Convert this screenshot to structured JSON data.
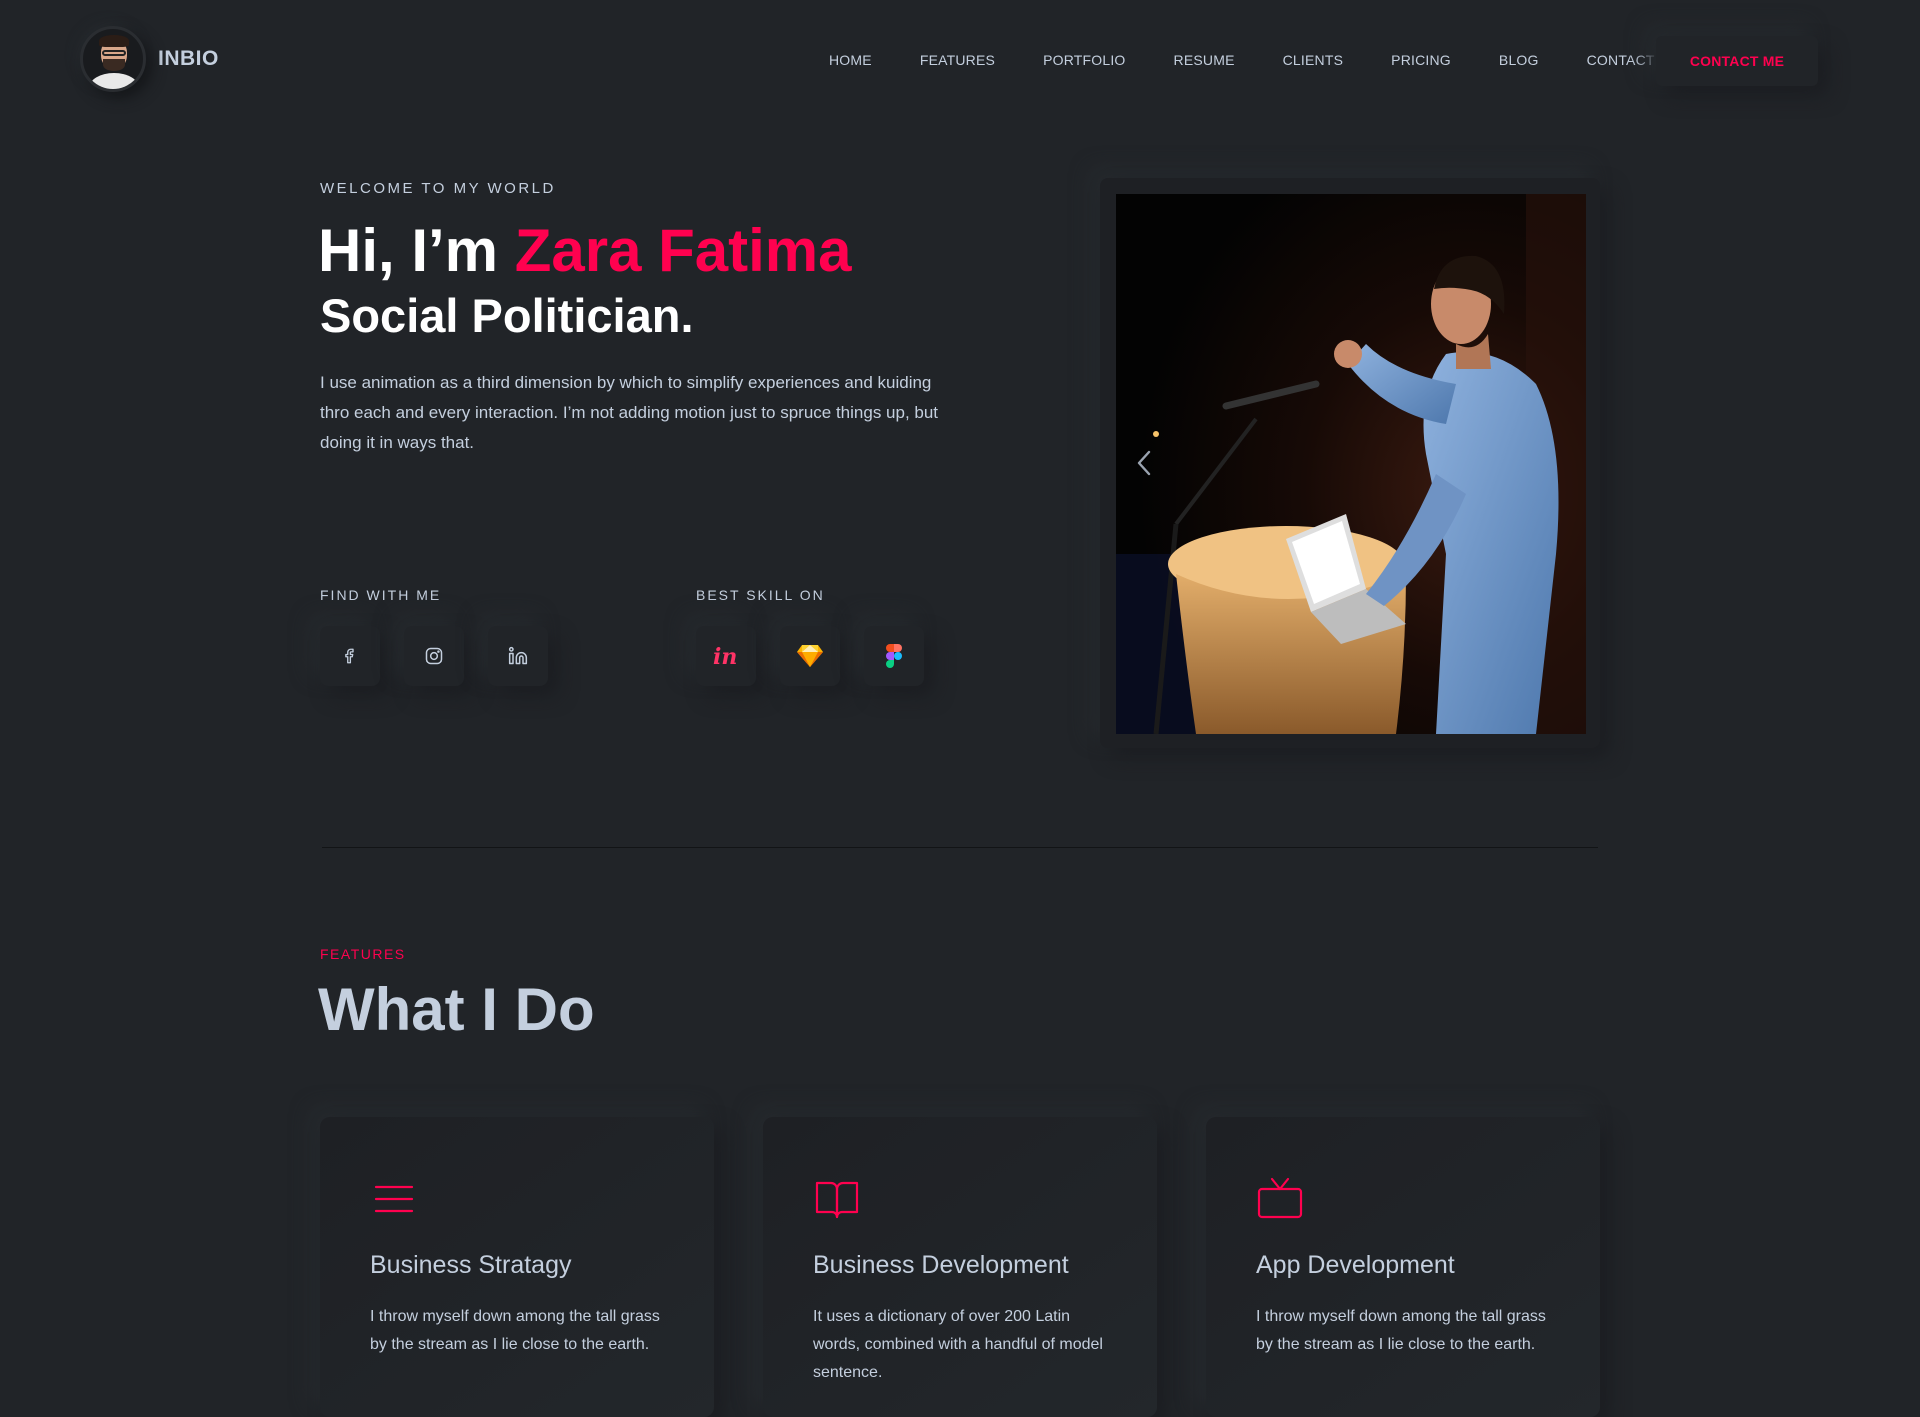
{
  "header": {
    "brand": "INBIO",
    "nav": [
      "HOME",
      "FEATURES",
      "PORTFOLIO",
      "RESUME",
      "CLIENTS",
      "PRICING",
      "BLOG",
      "CONTACT"
    ],
    "cta": "CONTACT ME"
  },
  "hero": {
    "subtitle": "WELCOME TO MY WORLD",
    "greeting": "Hi, I’m ",
    "name": "Zara Fatima",
    "role": "Social Politician.",
    "description": "I use animation as a third dimension by which to simplify experiences and kuiding thro each and every interaction. I’m not adding motion just to spruce things up, but doing it in ways that.",
    "find_label": "FIND WITH ME",
    "skill_label": "BEST SKILL ON",
    "social_icons": [
      "facebook-icon",
      "instagram-icon",
      "linkedin-icon"
    ],
    "skill_icons": [
      "invision-icon",
      "sketch-icon",
      "figma-icon"
    ]
  },
  "features": {
    "subtitle": "FEATURES",
    "title": "What I Do",
    "cards": [
      {
        "icon": "menu-lines-icon",
        "title": "Business Stratagy",
        "description": "I throw myself down among the tall grass by the stream as I lie close to the earth."
      },
      {
        "icon": "book-icon",
        "title": "Business Development",
        "description": "It uses a dictionary of over 200 Latin words, combined with a handful of model sentence."
      },
      {
        "icon": "tv-icon",
        "title": "App Development",
        "description": "I throw myself down among the tall grass by the stream as I lie close to the earth."
      }
    ]
  },
  "colors": {
    "background": "#212428",
    "accent": "#ff014f",
    "text": "#c4cfde",
    "heading": "#ffffff"
  }
}
